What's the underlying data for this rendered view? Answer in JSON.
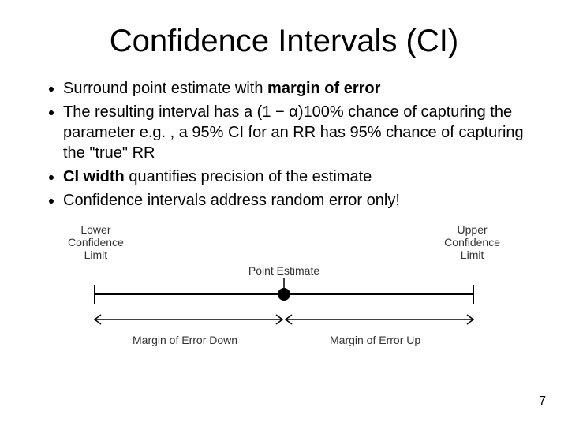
{
  "title": "Confidence Intervals (CI)",
  "bullets": {
    "b1_pre": "Surround point estimate with ",
    "b1_strong": "margin of error",
    "b2": "The resulting interval has a (1 − α)100% chance of capturing the parameter e.g. , a 95% CI for an RR has 95% chance of capturing the \"true\" RR",
    "b3_strong": "CI width",
    "b3_post": " quantifies precision of the estimate",
    "b4": "Confidence intervals address random error only!"
  },
  "diagram": {
    "lower_line1": "Lower",
    "lower_line2": "Confidence",
    "lower_line3": "Limit",
    "upper_line1": "Upper",
    "upper_line2": "Confidence",
    "upper_line3": "Limit",
    "point_estimate": "Point Estimate",
    "margin_down": "Margin of Error Down",
    "margin_up": "Margin of Error Up"
  },
  "page_number": "7"
}
